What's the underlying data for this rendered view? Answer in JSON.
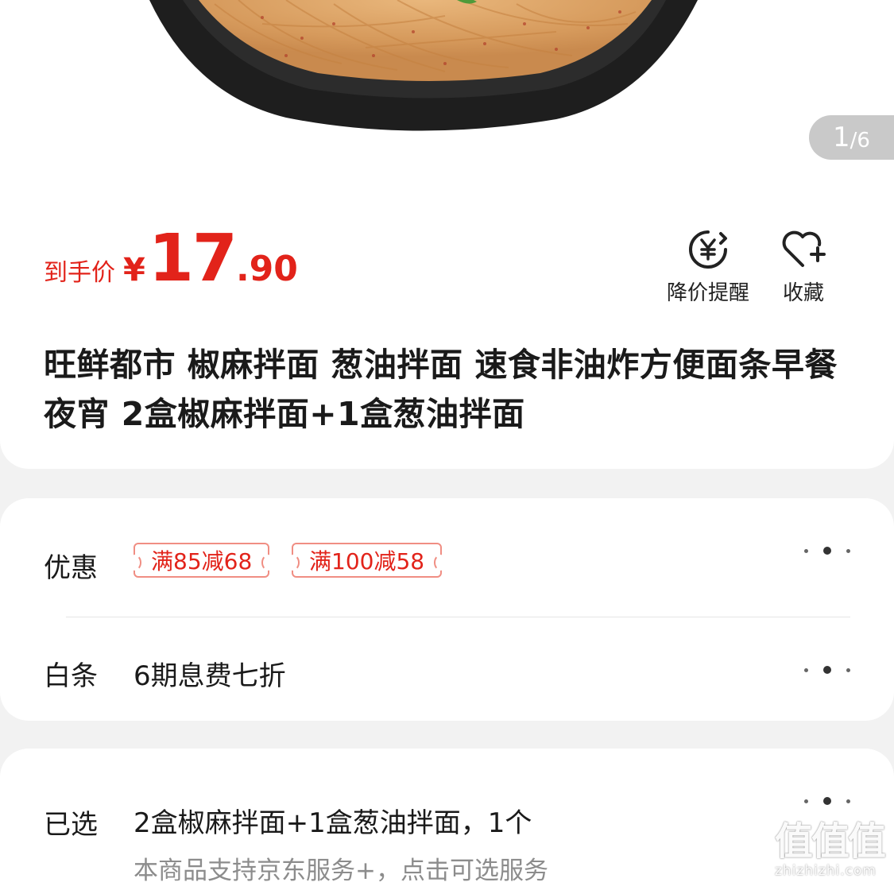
{
  "gallery": {
    "current": "1",
    "total": "/6"
  },
  "price": {
    "label": "到手价",
    "currency": "¥",
    "integer": "17",
    "decimal": ".90",
    "color": "#e2231a"
  },
  "actions": {
    "price_alert": {
      "label": "降价提醒",
      "icon": "yen-bell-icon"
    },
    "favorite": {
      "label": "收藏",
      "icon": "heart-plus-icon"
    }
  },
  "product": {
    "title": "旺鲜都市 椒麻拌面 葱油拌面 速食非油炸方便面条早餐夜宵 2盒椒麻拌面+1盒葱油拌面"
  },
  "promotions": {
    "label": "优惠",
    "coupons": [
      "满85减68",
      "满100减58"
    ]
  },
  "baitiao": {
    "label": "白条",
    "value": "6期息费七折"
  },
  "selection": {
    "label": "已选",
    "value": "2盒椒麻拌面+1盒葱油拌面，1个",
    "service_note": "本商品支持京东服务+，点击可选服务"
  },
  "watermark": {
    "glyphs": "值值值",
    "domain": "zhizhizhi.com"
  }
}
